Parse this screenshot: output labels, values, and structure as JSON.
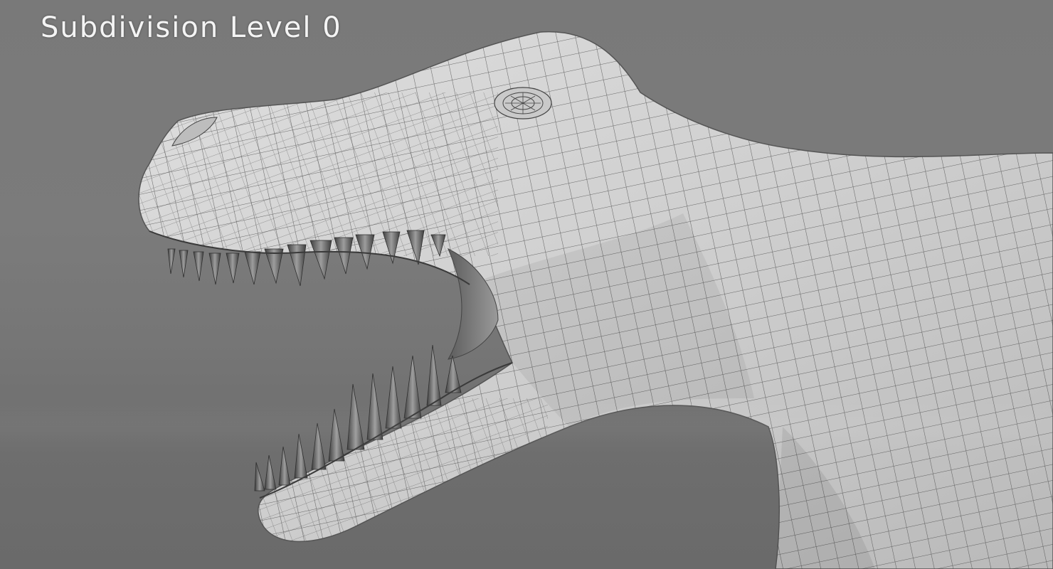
{
  "viewport": {
    "overlay_title": "Subdivision Level 0"
  },
  "colors": {
    "background": "#7a7a7a",
    "mesh_surface": "#d6d6d6",
    "wireframe": "#3a3a3a",
    "overlay_text": "#f4f4f4"
  },
  "model": {
    "subject": "dinosaur-head-wireframe"
  }
}
